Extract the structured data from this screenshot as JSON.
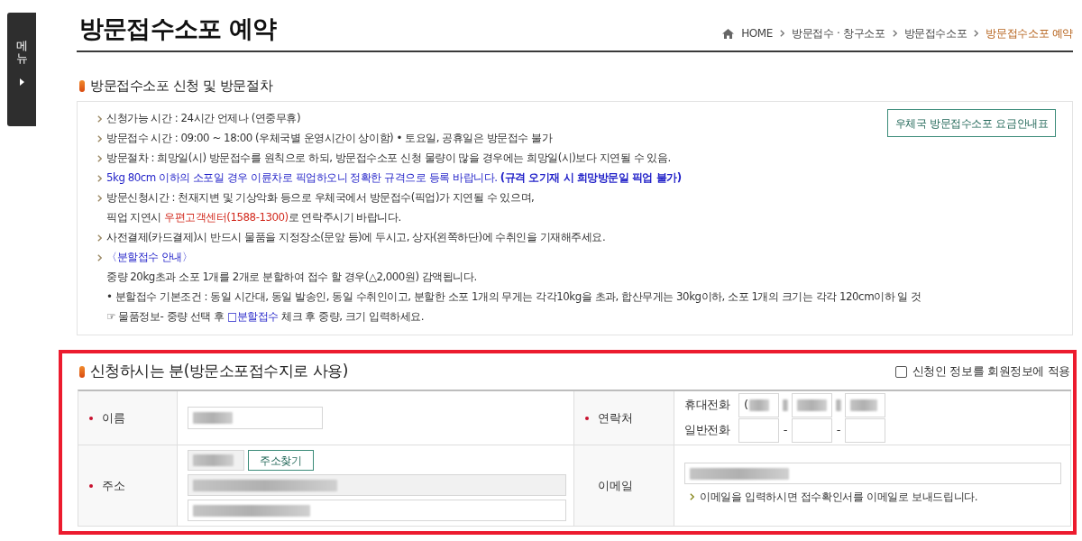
{
  "side_tab": {
    "label": "메뉴"
  },
  "page_title": "방문접수소포 예약",
  "breadcrumb": [
    {
      "label": "HOME",
      "kind": "home",
      "selected": false
    },
    {
      "label": "방문접수 · 창구소포",
      "kind": "link",
      "selected": false
    },
    {
      "label": "방문접수소포",
      "kind": "link",
      "selected": false
    },
    {
      "label": "방문접수소포 예약",
      "kind": "link",
      "selected": true
    }
  ],
  "notice_section": {
    "heading": "방문접수소포 신청 및 방문절차",
    "fee_button": "우체국 방문접수소포 요금안내표",
    "items": [
      {
        "bullet": true,
        "segments": [
          {
            "text": "신청가능 시간 : 24시간 언제나 (연중무휴)",
            "kind": "plain"
          }
        ]
      },
      {
        "bullet": true,
        "segments": [
          {
            "text": "방문접수 시간 : 09:00 ~ 18:00 (우체국별 운영시간이 상이함) • 토요일, 공휴일은 방문접수 불가",
            "kind": "plain"
          }
        ]
      },
      {
        "bullet": true,
        "segments": [
          {
            "text": "방문절차 : 희망일(시) 방문접수를 원칙으로 하되, 방문접수소포 신청 물량이 많을 경우에는 희망일(시)보다 지연될 수 있음.",
            "kind": "plain"
          }
        ]
      },
      {
        "bullet": true,
        "segments": [
          {
            "text": "5kg 80cm 이하의 소포일 경우 이륜차로 픽업하오니 정확한 규격으로 등록 바랍니다. **(규격 오기재 시 희망방문일 픽업 불가)**",
            "kind": "info"
          }
        ]
      },
      {
        "bullet": true,
        "segments": [
          {
            "text": "방문신청시간 : 천재지변 및 기상악화 등으로 우체국에서 방문접수(픽업)가 지연될 수 있으며,",
            "kind": "plain"
          }
        ]
      },
      {
        "bullet": false,
        "segments": [
          {
            "text": "픽업 지연시 ",
            "kind": "plain"
          },
          {
            "text": "우편고객센터(1588-1300)",
            "kind": "alert"
          },
          {
            "text": "로 연락주시기 바랍니다.",
            "kind": "plain"
          }
        ]
      },
      {
        "bullet": true,
        "segments": [
          {
            "text": "사전결제(카드결제)시 반드시 물품을 지정장소(문앞 등)에 두시고, 상자(왼쪽하단)에 수취인을 기재해주세요.",
            "kind": "plain"
          }
        ]
      },
      {
        "bullet": true,
        "segments": [
          {
            "text": "〈분할접수 안내〉",
            "kind": "info"
          }
        ]
      },
      {
        "bullet": false,
        "segments": [
          {
            "text": "중량 20kg초과 소포 1개를 2개로 분할하여 접수 할 경우(△2,000원) 감액됩니다.",
            "kind": "plain"
          }
        ]
      },
      {
        "bullet": false,
        "segments": [
          {
            "text": "• 분할접수 기본조건 : 동일 시간대, 동일 발송인, 동일 수취인이고, 분할한 소포 1개의 무게는 각각10kg을 초과, 합산무게는 30kg이하, 소포 1개의 크기는 각각 120cm이하 일 것",
            "kind": "plain"
          }
        ]
      },
      {
        "bullet": false,
        "segments": [
          {
            "text": "☞ 물품정보- 중량 선택 후 ",
            "kind": "plain"
          },
          {
            "text": "□분할접수",
            "kind": "info"
          },
          {
            "text": " 체크 후 중량, 크기 입력하세요.",
            "kind": "plain"
          }
        ]
      }
    ]
  },
  "applicant_section": {
    "heading": "신청하시는 분(방문소포접수지로 사용)",
    "highlighted": true,
    "apply_checkbox": {
      "label": "신청인 정보를 회원정보에 적용",
      "checked": false
    },
    "name": {
      "label": "이름",
      "required": true,
      "field": {
        "blurred": true,
        "readonly": false
      }
    },
    "contact": {
      "label": "연락처",
      "required": true,
      "lines": [
        {
          "label": "휴대전화",
          "parts": [
            {
              "kind": "field",
              "value": "(",
              "blurred": true
            },
            {
              "kind": "separator",
              "blurred": true
            },
            {
              "kind": "field",
              "blurred": true
            },
            {
              "kind": "separator",
              "blurred": true
            },
            {
              "kind": "field",
              "blurred": true
            }
          ]
        },
        {
          "label": "일반전화",
          "parts": [
            {
              "kind": "field",
              "blurred": false
            },
            {
              "kind": "separator",
              "text": "-",
              "blurred": false
            },
            {
              "kind": "field",
              "blurred": false
            },
            {
              "kind": "separator",
              "text": "-",
              "blurred": false
            },
            {
              "kind": "field",
              "blurred": false
            }
          ]
        }
      ]
    },
    "address": {
      "label": "주소",
      "required": true,
      "postcode": {
        "blurred": true,
        "readonly": true
      },
      "search_button": "주소찾기",
      "lines": [
        {
          "blurred": true,
          "readonly": true
        },
        {
          "blurred": true,
          "readonly": false
        }
      ]
    },
    "email": {
      "label": "이메일",
      "required": false,
      "field": {
        "blurred": true,
        "readonly": false
      },
      "note": "이메일을 입력하시면 접수확인서를 이메일로 보내드립니다."
    }
  }
}
